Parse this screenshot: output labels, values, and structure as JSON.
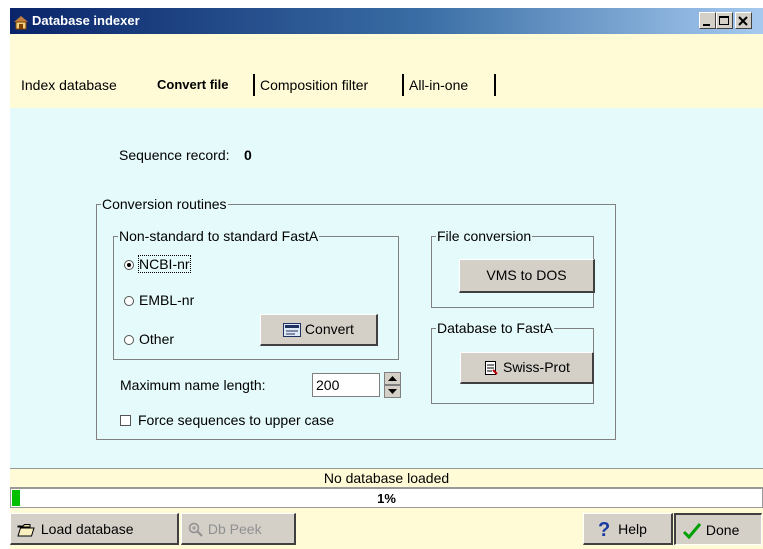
{
  "window": {
    "title": "Database indexer"
  },
  "tabs": [
    {
      "label": "Index database"
    },
    {
      "label": "Convert file"
    },
    {
      "label": "Composition filter"
    },
    {
      "label": "All-in-one"
    }
  ],
  "sequence_record": {
    "label": "Sequence record:",
    "value": "0"
  },
  "conversion": {
    "title": "Conversion routines",
    "nonstandard": {
      "title": "Non-standard to standard FastA",
      "options": [
        {
          "label": "NCBI-nr",
          "selected": true
        },
        {
          "label": "EMBL-nr",
          "selected": false
        },
        {
          "label": "Other",
          "selected": false
        }
      ],
      "convert_button": "Convert"
    },
    "file_conversion": {
      "title": "File conversion",
      "button": "VMS to DOS"
    },
    "database_to_fasta": {
      "title": "Database to FastA",
      "button": "Swiss-Prot"
    },
    "max_name_length": {
      "label": "Maximum name length:",
      "value": "200"
    },
    "force_upper": {
      "label": "Force sequences to upper case",
      "checked": false
    }
  },
  "status": {
    "text": "No database loaded"
  },
  "progress": {
    "percent_label": "1%",
    "fraction": 0.01,
    "color": "#00c000"
  },
  "bottom": {
    "load_button": "Load database",
    "peek_button": "Db Peek",
    "help_button": "Help",
    "done_button": "Done"
  },
  "colors": {
    "panel": "#e5fafa",
    "bars": "#fffbd6",
    "titlebar": "#0a246a"
  }
}
